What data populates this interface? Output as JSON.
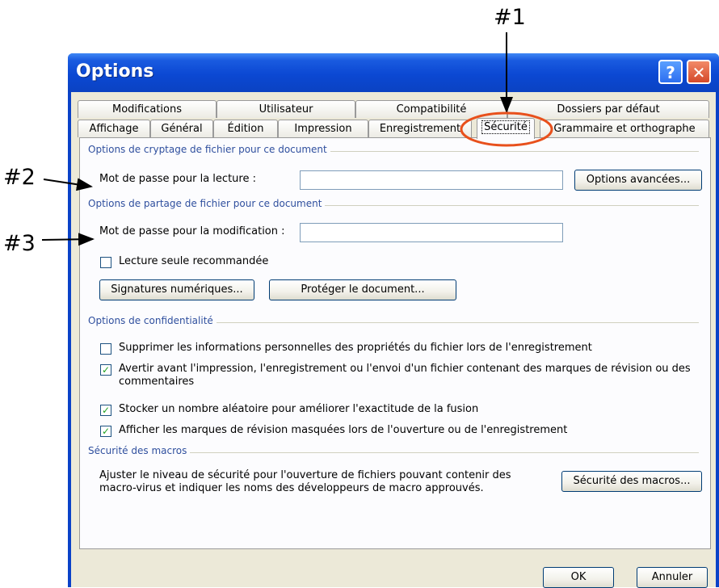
{
  "callouts": [
    "#1",
    "#2",
    "#3"
  ],
  "window": {
    "title": "Options",
    "help_glyph": "?",
    "close_glyph": "✕"
  },
  "tabs_row1": [
    "Modifications",
    "Utilisateur",
    "Compatibilité",
    "Dossiers par défaut"
  ],
  "tabs_row2": [
    "Affichage",
    "Général",
    "Édition",
    "Impression",
    "Enregistrement",
    "Sécurité",
    "Grammaire et orthographe"
  ],
  "active_tab": "Sécurité",
  "encryption": {
    "title": "Options de cryptage de fichier pour ce document",
    "read_password_label": "Mot de passe pour la lecture :",
    "read_password_value": "",
    "advanced_button": "Options avancées..."
  },
  "sharing": {
    "title": "Options de partage de fichier pour ce document",
    "modify_password_label": "Mot de passe pour la modification :",
    "modify_password_value": "",
    "readonly_label": "Lecture seule recommandée",
    "readonly_checked": false,
    "signatures_button": "Signatures numériques...",
    "protect_button": "Protéger le document..."
  },
  "privacy": {
    "title": "Options de confidentialité",
    "items": [
      {
        "label": "Supprimer les informations personnelles des propriétés du fichier lors de l'enregistrement",
        "checked": false
      },
      {
        "label": "Avertir avant l'impression, l'enregistrement ou l'envoi d'un fichier contenant des marques de révision ou des commentaires",
        "checked": true
      },
      {
        "label": "Stocker un nombre aléatoire pour améliorer l'exactitude de la fusion",
        "checked": true
      },
      {
        "label": "Afficher les marques de révision masquées lors de l'ouverture ou de l'enregistrement",
        "checked": true
      }
    ]
  },
  "macros": {
    "title": "Sécurité des macros",
    "description": "Ajuster le niveau de sécurité pour l'ouverture de fichiers pouvant contenir des macro-virus et indiquer les noms des développeurs de macro approuvés.",
    "button": "Sécurité des macros..."
  },
  "footer": {
    "ok": "OK",
    "cancel": "Annuler"
  },
  "colors": {
    "title_bar": "#0b48d3",
    "dialog_bg": "#ece9d8",
    "group_title": "#2f4f9e",
    "highlight_circle": "#e8501c"
  }
}
